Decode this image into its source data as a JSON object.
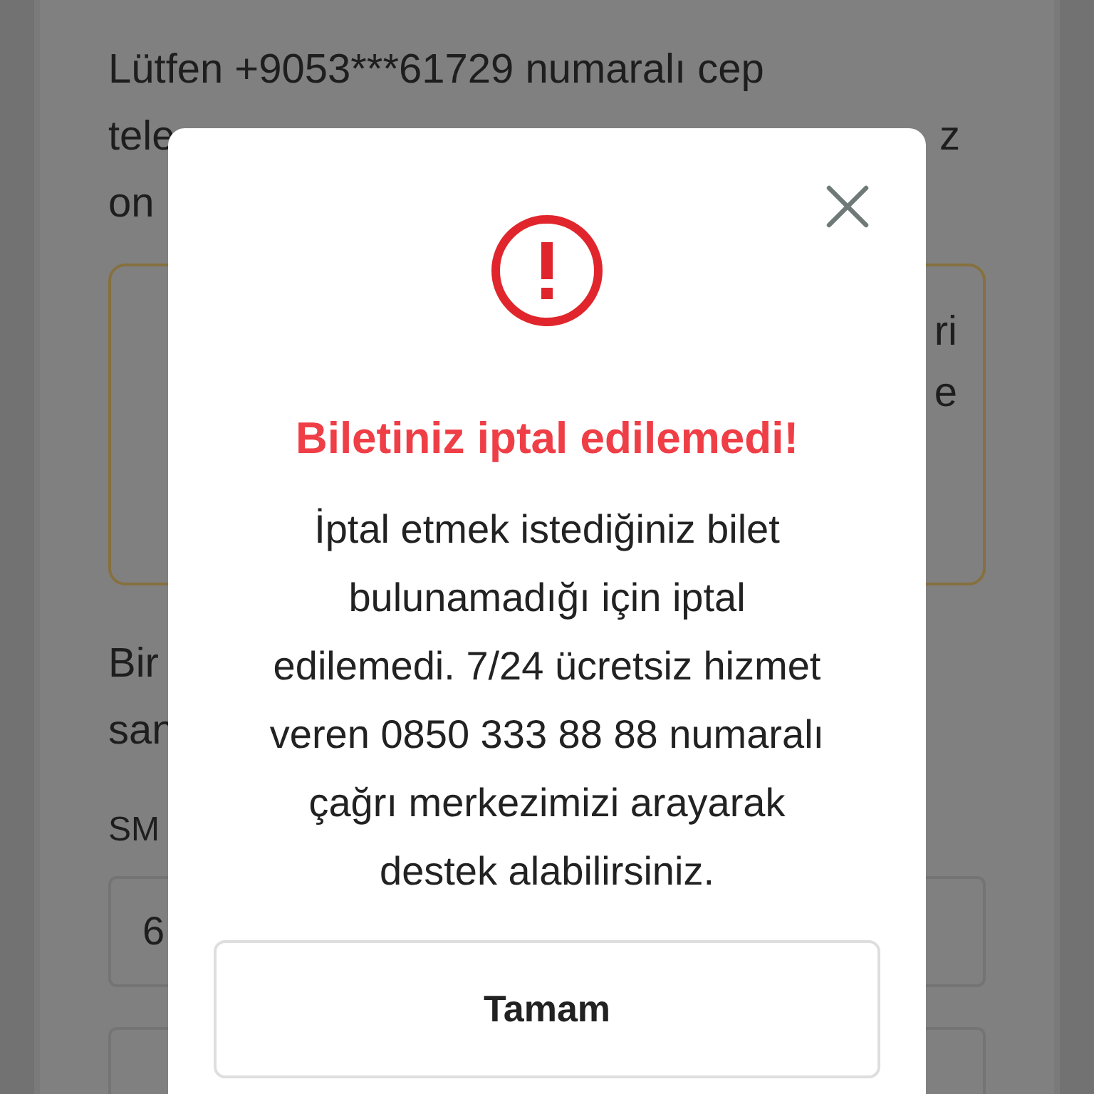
{
  "background": {
    "intro_lines": [
      {
        "left": "Lütfen +9053***61729 numaralı cep"
      },
      {
        "left": "tele",
        "right": "z"
      },
      {
        "left": "on"
      }
    ],
    "notice_box": {
      "lines": [
        "ri",
        "e"
      ]
    },
    "paragraph_lines": [
      "Bir",
      "san"
    ],
    "sms_label": "SM",
    "code_field": {
      "value": "6"
    }
  },
  "dialog": {
    "title": "Biletiniz iptal edilemedi!",
    "message": "İptal etmek istediğiniz bilet\nbulunamadığı için iptal\nedilemedi. 7/24 ücretsiz hizmet\nveren 0850 333 88 88 numaralı\nçağrı merkezimizi arayarak\ndestek alabilirsiniz.",
    "button": "Tamam"
  }
}
